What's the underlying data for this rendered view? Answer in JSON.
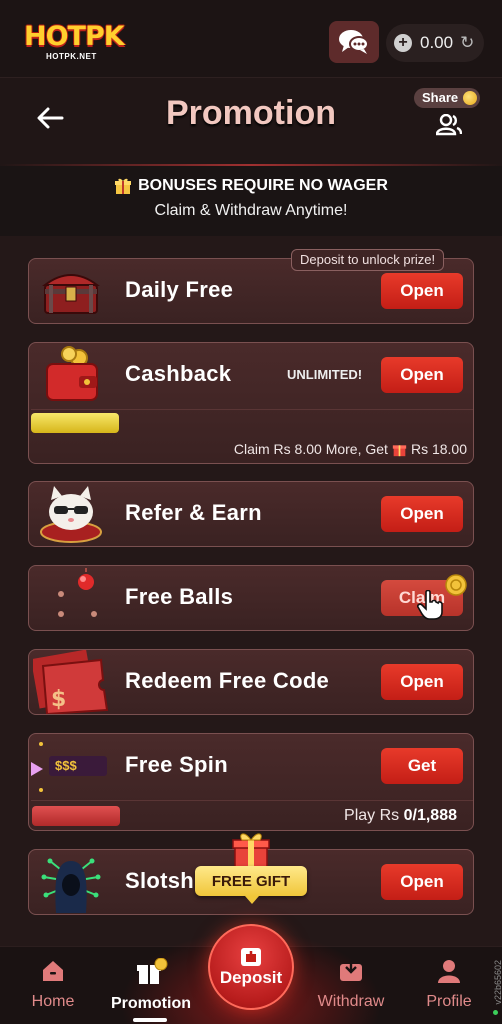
{
  "topbar": {
    "logo_text": "HOTPK",
    "logo_subtext": "HOTPK.NET",
    "balance": "0.00"
  },
  "header": {
    "title": "Promotion",
    "share_label": "Share"
  },
  "banner": {
    "line1": "BONUSES REQUIRE NO WAGER",
    "line2": "Claim & Withdraw Anytime!"
  },
  "cards": {
    "daily_free": {
      "title": "Daily Free",
      "button": "Open",
      "tag": "Deposit to unlock prize!"
    },
    "cashback": {
      "title": "Cashback",
      "button": "Open",
      "badge": "UNLIMITED!",
      "note_prefix": "Claim Rs 8.00 More, Get",
      "note_suffix": "Rs 18.00",
      "progress_fraction": 0.2
    },
    "refer": {
      "title": "Refer & Earn",
      "button": "Open"
    },
    "free_balls": {
      "title": "Free Balls",
      "button": "Claim"
    },
    "redeem": {
      "title": "Redeem Free Code",
      "button": "Open"
    },
    "free_spin": {
      "title": "Free Spin",
      "button": "Get",
      "thumb_text": "$$$",
      "note_prefix": "Play Rs",
      "note_value": "0/1,888"
    },
    "slotsh": {
      "title": "Slotsh",
      "button": "Open",
      "overlay": "FREE GIFT"
    }
  },
  "nav": {
    "home": "Home",
    "promotion": "Promotion",
    "deposit": "Deposit",
    "withdraw": "Withdraw",
    "profile": "Profile"
  },
  "version": "v22b65602",
  "colors": {
    "accent_red": "#d42a1e",
    "gold": "#f0c63a",
    "nav_inactive": "#e08a8a"
  }
}
